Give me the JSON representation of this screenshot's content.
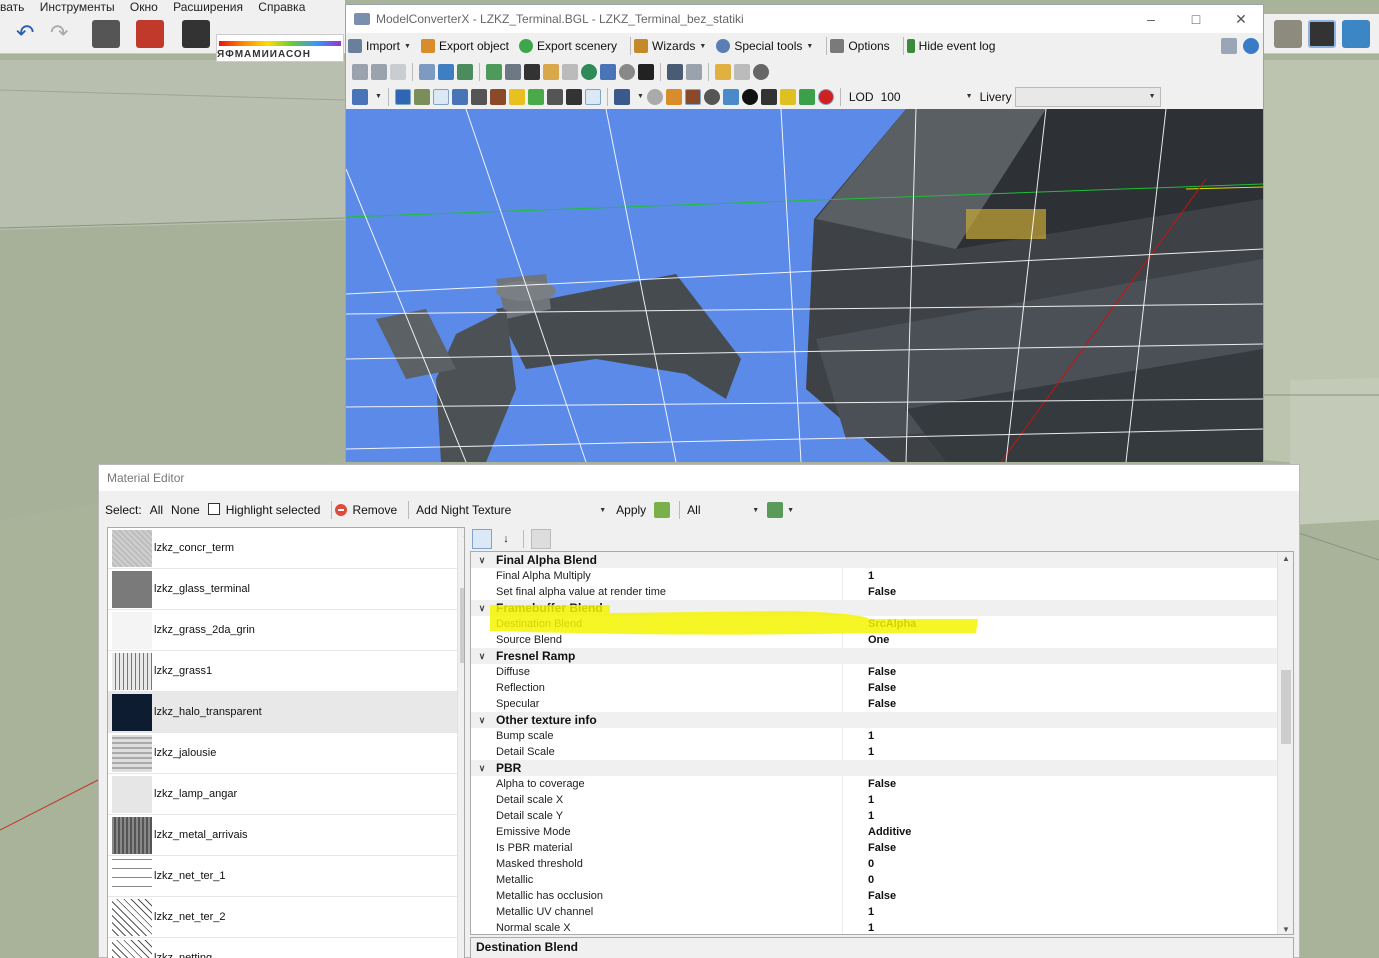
{
  "background": {
    "menu_items": [
      "вать",
      "Инструменты",
      "Окно",
      "Расширения",
      "Справка"
    ],
    "toolbar_strip_text": "ЯФМАМИИАСОН"
  },
  "mcx": {
    "title": "ModelConverterX - LZKZ_Terminal.BGL - LZKZ_Terminal_bez_statiki",
    "menu": {
      "import": "Import",
      "export_object": "Export object",
      "export_scenery": "Export scenery",
      "wizards": "Wizards",
      "special_tools": "Special tools",
      "options": "Options",
      "hide_event_log": "Hide event log"
    },
    "lod_label": "LOD",
    "lod_value": "100",
    "livery_label": "Livery",
    "livery_value": ""
  },
  "material_editor": {
    "title": "Material Editor",
    "toolbar": {
      "select_label": "Select:",
      "all": "All",
      "none": "None",
      "highlight_selected": "Highlight selected",
      "remove": "Remove",
      "add_night_texture": "Add Night Texture",
      "apply": "Apply",
      "filter": "All"
    },
    "materials": [
      {
        "name": "lzkz_concr_term",
        "selected": false,
        "swatch": "concrete"
      },
      {
        "name": "lzkz_glass_terminal",
        "selected": false,
        "swatch": "glass"
      },
      {
        "name": "lzkz_grass_2da_grin",
        "selected": false,
        "swatch": "blank"
      },
      {
        "name": "lzkz_grass1",
        "selected": false,
        "swatch": "grass"
      },
      {
        "name": "lzkz_halo_transparent",
        "selected": true,
        "swatch": "dark-navy"
      },
      {
        "name": "lzkz_jalousie",
        "selected": false,
        "swatch": "stripes"
      },
      {
        "name": "lzkz_lamp_angar",
        "selected": false,
        "swatch": "light"
      },
      {
        "name": "lzkz_metal_arrivais",
        "selected": false,
        "swatch": "metal"
      },
      {
        "name": "lzkz_net_ter_1",
        "selected": false,
        "swatch": "net"
      },
      {
        "name": "lzkz_net_ter_2",
        "selected": false,
        "swatch": "mesh"
      },
      {
        "name": "lzkz_netting",
        "selected": false,
        "swatch": "mesh"
      }
    ],
    "properties": [
      {
        "category": "Final Alpha Blend",
        "rows": [
          {
            "name": "Final Alpha Multiply",
            "value": "1"
          },
          {
            "name": "Set final alpha value at render time",
            "value": "False"
          }
        ]
      },
      {
        "category": "Framebuffer Blend",
        "rows": [
          {
            "name": "Destination Blend",
            "value": "SrcAlpha"
          },
          {
            "name": "Source Blend",
            "value": "One"
          }
        ]
      },
      {
        "category": "Fresnel Ramp",
        "rows": [
          {
            "name": "Diffuse",
            "value": "False"
          },
          {
            "name": "Reflection",
            "value": "False"
          },
          {
            "name": "Specular",
            "value": "False"
          }
        ]
      },
      {
        "category": "Other texture info",
        "rows": [
          {
            "name": "Bump scale",
            "value": "1"
          },
          {
            "name": "Detail Scale",
            "value": "1"
          }
        ]
      },
      {
        "category": "PBR",
        "rows": [
          {
            "name": "Alpha to coverage",
            "value": "False"
          },
          {
            "name": "Detail scale X",
            "value": "1"
          },
          {
            "name": "Detail scale Y",
            "value": "1"
          },
          {
            "name": "Emissive Mode",
            "value": "Additive"
          },
          {
            "name": "Is PBR material",
            "value": "False"
          },
          {
            "name": "Masked threshold",
            "value": "0"
          },
          {
            "name": "Metallic",
            "value": "0"
          },
          {
            "name": "Metallic has occlusion",
            "value": "False"
          },
          {
            "name": "Metallic UV channel",
            "value": "1"
          },
          {
            "name": "Normal scale X",
            "value": "1"
          }
        ]
      }
    ],
    "description_title": "Destination Blend",
    "highlight_color": "#f5f500"
  }
}
